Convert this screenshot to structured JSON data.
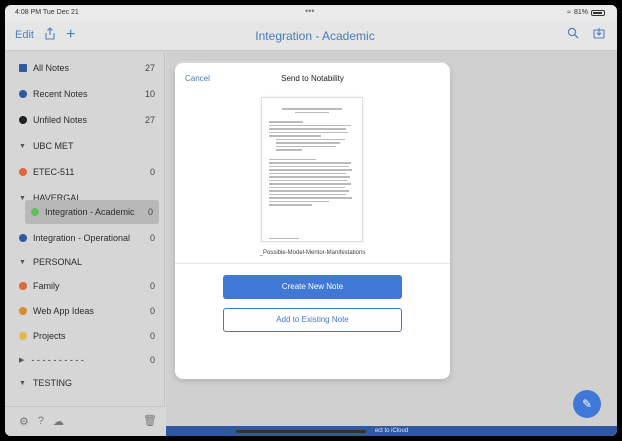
{
  "status": {
    "time": "4:08 PM  Tue Dec 21",
    "dots": "•••",
    "battery": "81%"
  },
  "nav": {
    "edit_label": "Edit",
    "title": "Integration - Academic"
  },
  "sidebar": {
    "items": [
      {
        "label": "All Notes",
        "count": "27",
        "color": "#2f5aa3"
      },
      {
        "label": "Recent Notes",
        "count": "10",
        "color": "#2f5aa3"
      },
      {
        "label": "Unfiled Notes",
        "count": "27",
        "color": "#222222"
      },
      {
        "label": "UBC MET",
        "section": true
      },
      {
        "label": "ETEC-511",
        "count": "0",
        "color": "#e0663c"
      },
      {
        "label": "HAVERGAL",
        "section": true
      },
      {
        "label": "Integration - Academic",
        "count": "0",
        "color": "#5fbf5a",
        "selected": true
      },
      {
        "label": "Integration - Operational",
        "count": "0",
        "color": "#2f5aa3"
      },
      {
        "label": "PERSONAL",
        "section": true
      },
      {
        "label": "Family",
        "count": "0",
        "color": "#e0663c"
      },
      {
        "label": "Web App Ideas",
        "count": "0",
        "color": "#d98b2e"
      },
      {
        "label": "Projects",
        "count": "0",
        "color": "#e0b84a"
      },
      {
        "label": "- - - - - - - - - -",
        "count": "0",
        "collapsed": true
      },
      {
        "label": "TESTING",
        "section": true
      }
    ]
  },
  "modal": {
    "cancel": "Cancel",
    "title": "Send to Notability",
    "filename": "_Possible-Model-Mentor-Manifestations",
    "create_button": "Create New Note",
    "add_button": "Add to Existing Note"
  },
  "bottombar": {
    "text": "ect to iCloud"
  }
}
